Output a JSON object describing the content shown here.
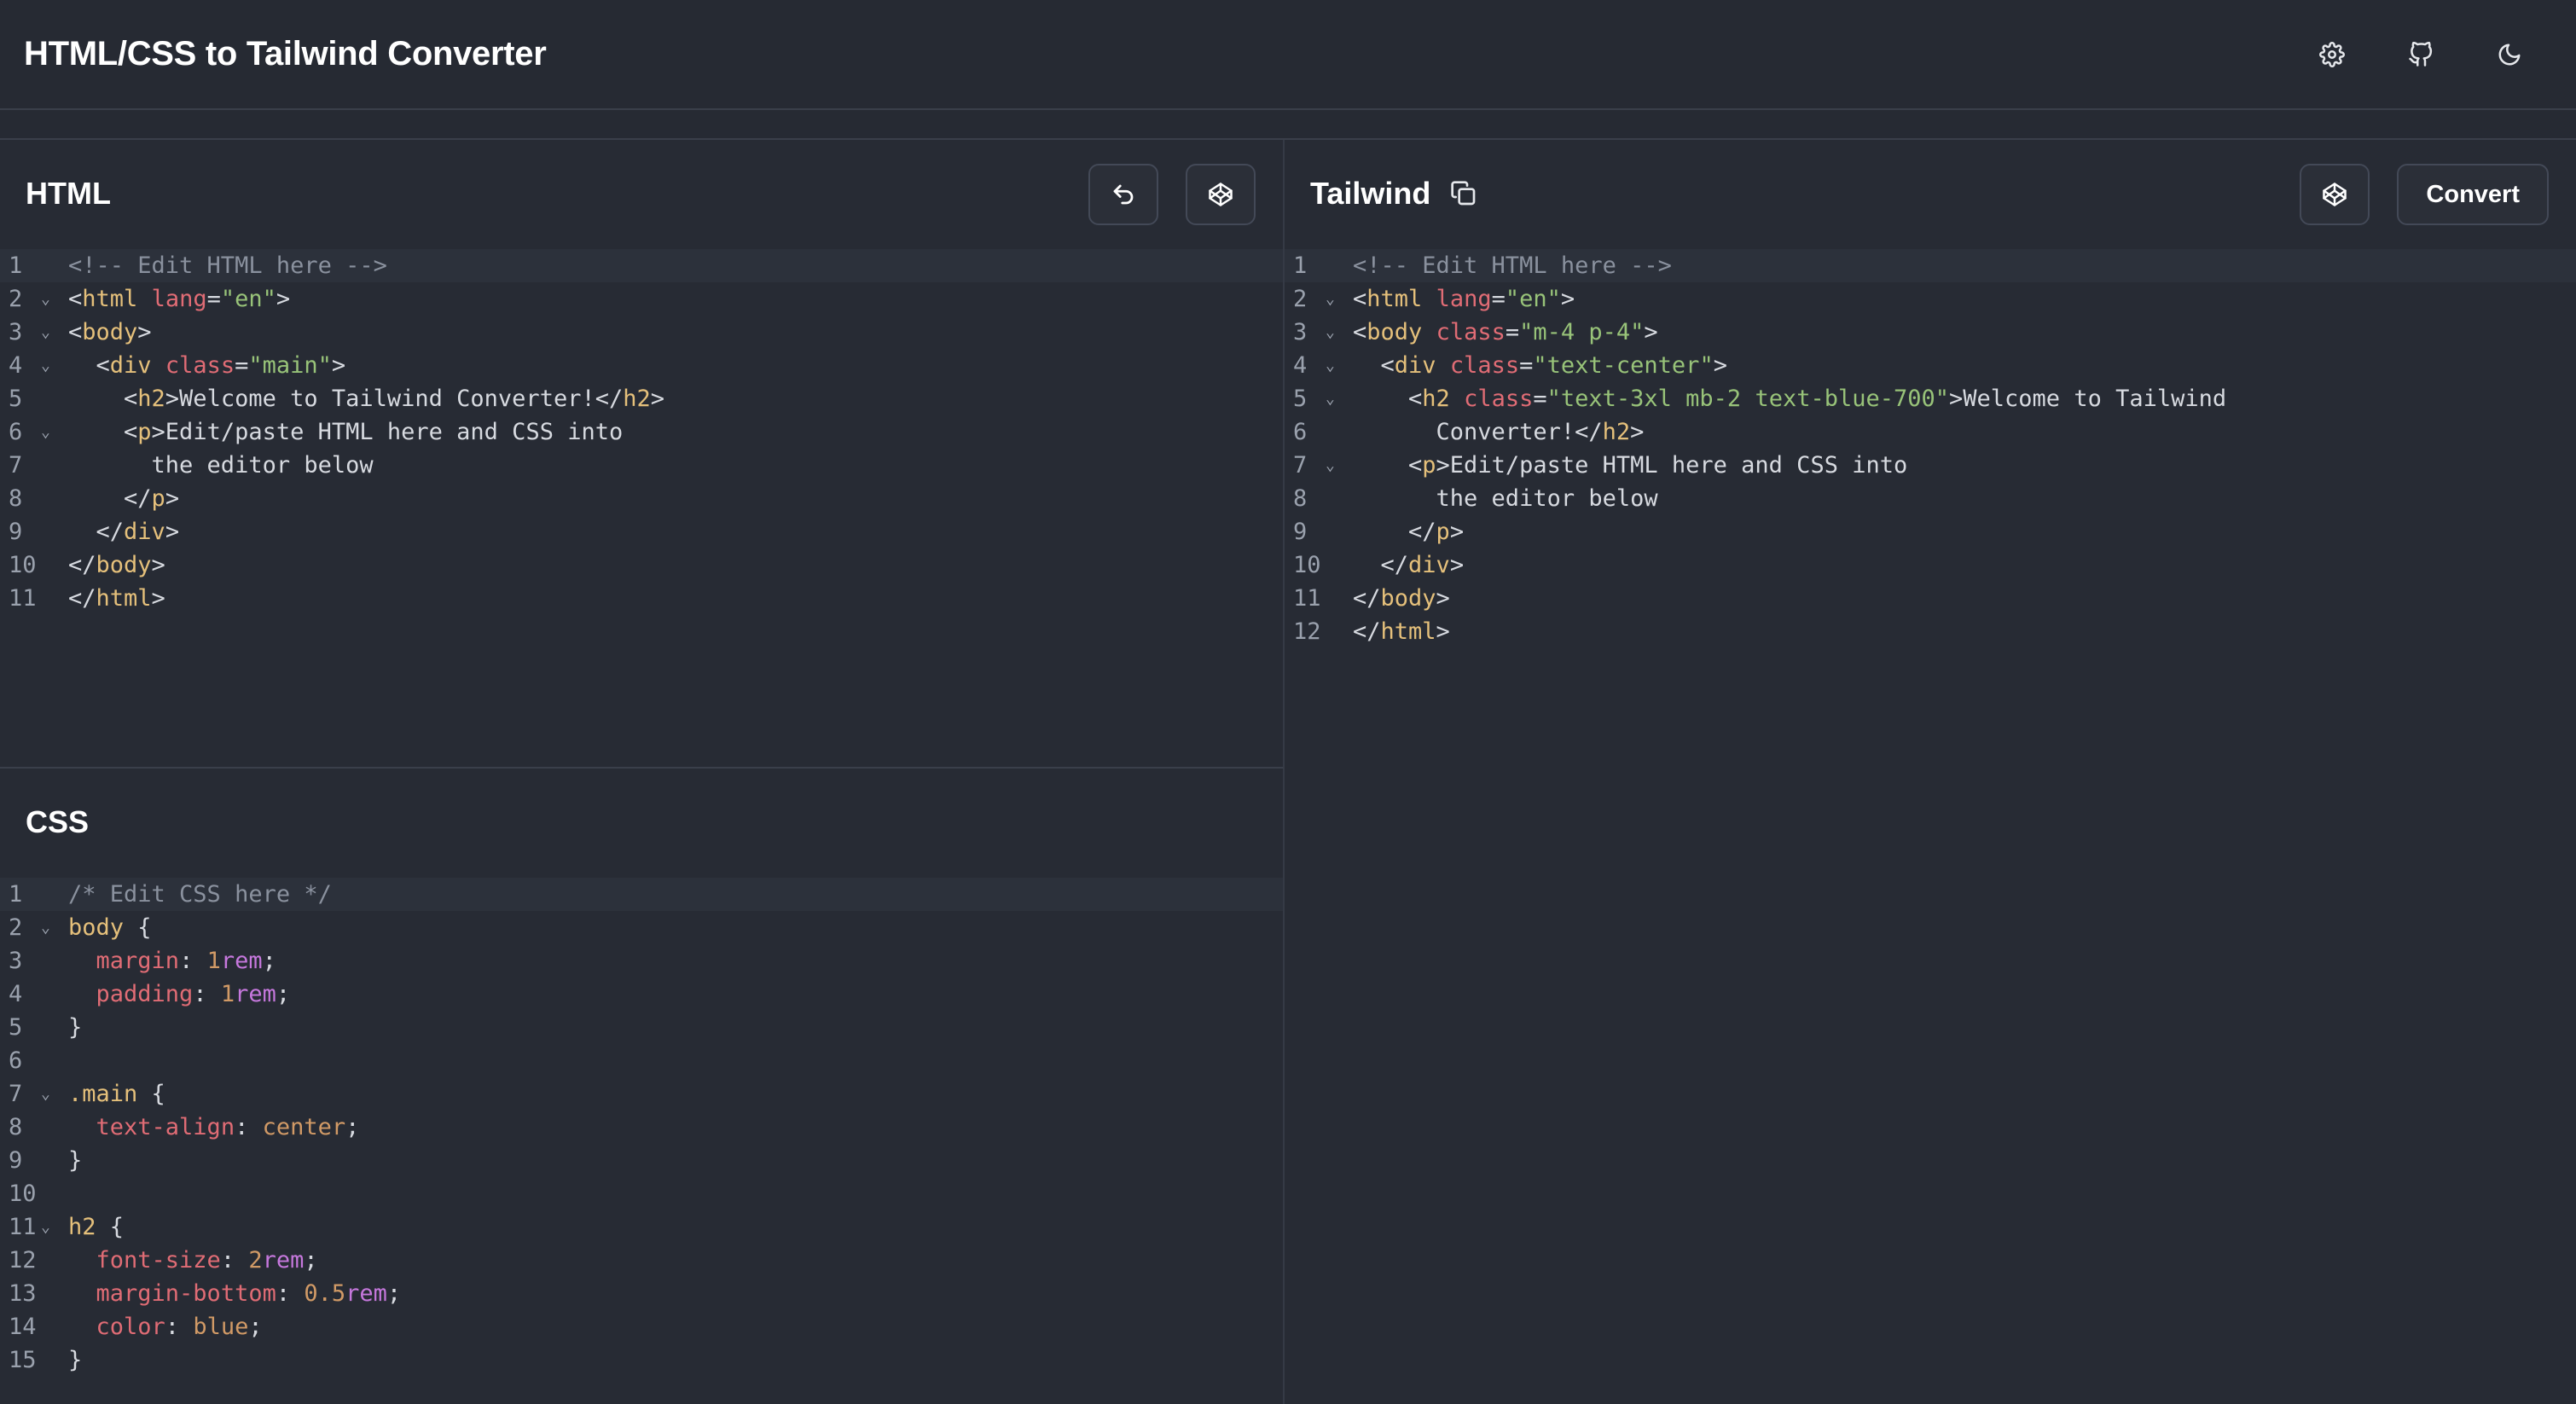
{
  "app": {
    "title": "HTML/CSS to Tailwind Converter",
    "icons": [
      "gear-icon",
      "github-icon",
      "moon-icon"
    ]
  },
  "html_pane": {
    "title": "HTML",
    "buttons": {
      "undo": "undo-icon",
      "codepen": "codepen-icon"
    },
    "lines": [
      [
        {
          "t": "<!-- Edit HTML here -->",
          "c": "com"
        }
      ],
      [
        {
          "t": "<",
          "c": "txt"
        },
        {
          "t": "html",
          "c": "tag"
        },
        {
          "t": " ",
          "c": "txt"
        },
        {
          "t": "lang",
          "c": "attr"
        },
        {
          "t": "=",
          "c": "txt"
        },
        {
          "t": "\"en\"",
          "c": "str"
        },
        {
          "t": ">",
          "c": "txt"
        }
      ],
      [
        {
          "t": "<",
          "c": "txt"
        },
        {
          "t": "body",
          "c": "tag"
        },
        {
          "t": ">",
          "c": "txt"
        }
      ],
      [
        {
          "t": "  <",
          "c": "txt"
        },
        {
          "t": "div",
          "c": "tag"
        },
        {
          "t": " ",
          "c": "txt"
        },
        {
          "t": "class",
          "c": "attr"
        },
        {
          "t": "=",
          "c": "txt"
        },
        {
          "t": "\"main\"",
          "c": "str"
        },
        {
          "t": ">",
          "c": "txt"
        }
      ],
      [
        {
          "t": "    <",
          "c": "txt"
        },
        {
          "t": "h2",
          "c": "tag"
        },
        {
          "t": ">Welcome to Tailwind Converter!</",
          "c": "txt"
        },
        {
          "t": "h2",
          "c": "tag"
        },
        {
          "t": ">",
          "c": "txt"
        }
      ],
      [
        {
          "t": "    <",
          "c": "txt"
        },
        {
          "t": "p",
          "c": "tag"
        },
        {
          "t": ">Edit/paste HTML here and CSS into",
          "c": "txt"
        }
      ],
      [
        {
          "t": "      the editor below",
          "c": "txt"
        }
      ],
      [
        {
          "t": "    </",
          "c": "txt"
        },
        {
          "t": "p",
          "c": "tag"
        },
        {
          "t": ">",
          "c": "txt"
        }
      ],
      [
        {
          "t": "  </",
          "c": "txt"
        },
        {
          "t": "div",
          "c": "tag"
        },
        {
          "t": ">",
          "c": "txt"
        }
      ],
      [
        {
          "t": "</",
          "c": "txt"
        },
        {
          "t": "body",
          "c": "tag"
        },
        {
          "t": ">",
          "c": "txt"
        }
      ],
      [
        {
          "t": "</",
          "c": "txt"
        },
        {
          "t": "html",
          "c": "tag"
        },
        {
          "t": ">",
          "c": "txt"
        }
      ]
    ],
    "folds": [
      2,
      3,
      4,
      6
    ]
  },
  "css_pane": {
    "title": "CSS",
    "lines": [
      [
        {
          "t": "/* Edit CSS here */",
          "c": "com"
        }
      ],
      [
        {
          "t": "body",
          "c": "sel"
        },
        {
          "t": " {",
          "c": "txt"
        }
      ],
      [
        {
          "t": "  ",
          "c": "txt"
        },
        {
          "t": "margin",
          "c": "prop"
        },
        {
          "t": ": ",
          "c": "txt"
        },
        {
          "t": "1",
          "c": "num"
        },
        {
          "t": "rem",
          "c": "unit"
        },
        {
          "t": ";",
          "c": "txt"
        }
      ],
      [
        {
          "t": "  ",
          "c": "txt"
        },
        {
          "t": "padding",
          "c": "prop"
        },
        {
          "t": ": ",
          "c": "txt"
        },
        {
          "t": "1",
          "c": "num"
        },
        {
          "t": "rem",
          "c": "unit"
        },
        {
          "t": ";",
          "c": "txt"
        }
      ],
      [
        {
          "t": "}",
          "c": "txt"
        }
      ],
      [],
      [
        {
          "t": ".main",
          "c": "sel"
        },
        {
          "t": " {",
          "c": "txt"
        }
      ],
      [
        {
          "t": "  ",
          "c": "txt"
        },
        {
          "t": "text-align",
          "c": "prop"
        },
        {
          "t": ": ",
          "c": "txt"
        },
        {
          "t": "center",
          "c": "val"
        },
        {
          "t": ";",
          "c": "txt"
        }
      ],
      [
        {
          "t": "}",
          "c": "txt"
        }
      ],
      [],
      [
        {
          "t": "h2",
          "c": "sel"
        },
        {
          "t": " {",
          "c": "txt"
        }
      ],
      [
        {
          "t": "  ",
          "c": "txt"
        },
        {
          "t": "font-size",
          "c": "prop"
        },
        {
          "t": ": ",
          "c": "txt"
        },
        {
          "t": "2",
          "c": "num"
        },
        {
          "t": "rem",
          "c": "unit"
        },
        {
          "t": ";",
          "c": "txt"
        }
      ],
      [
        {
          "t": "  ",
          "c": "txt"
        },
        {
          "t": "margin-bottom",
          "c": "prop"
        },
        {
          "t": ": ",
          "c": "txt"
        },
        {
          "t": "0.5",
          "c": "num"
        },
        {
          "t": "rem",
          "c": "unit"
        },
        {
          "t": ";",
          "c": "txt"
        }
      ],
      [
        {
          "t": "  ",
          "c": "txt"
        },
        {
          "t": "color",
          "c": "prop"
        },
        {
          "t": ": ",
          "c": "txt"
        },
        {
          "t": "blue",
          "c": "val"
        },
        {
          "t": ";",
          "c": "txt"
        }
      ],
      [
        {
          "t": "}",
          "c": "txt"
        }
      ]
    ],
    "folds": [
      2,
      7,
      11
    ]
  },
  "tailwind_pane": {
    "title": "Tailwind",
    "convert_label": "Convert",
    "buttons": {
      "copy": "copy-icon",
      "codepen": "codepen-icon"
    },
    "lines": [
      [
        {
          "t": "<!-- Edit HTML here -->",
          "c": "com"
        }
      ],
      [
        {
          "t": "<",
          "c": "txt"
        },
        {
          "t": "html",
          "c": "tag"
        },
        {
          "t": " ",
          "c": "txt"
        },
        {
          "t": "lang",
          "c": "attr"
        },
        {
          "t": "=",
          "c": "txt"
        },
        {
          "t": "\"en\"",
          "c": "str"
        },
        {
          "t": ">",
          "c": "txt"
        }
      ],
      [
        {
          "t": "<",
          "c": "txt"
        },
        {
          "t": "body",
          "c": "tag"
        },
        {
          "t": " ",
          "c": "txt"
        },
        {
          "t": "class",
          "c": "attr"
        },
        {
          "t": "=",
          "c": "txt"
        },
        {
          "t": "\"m-4 p-4\"",
          "c": "str"
        },
        {
          "t": ">",
          "c": "txt"
        }
      ],
      [
        {
          "t": "  <",
          "c": "txt"
        },
        {
          "t": "div",
          "c": "tag"
        },
        {
          "t": " ",
          "c": "txt"
        },
        {
          "t": "class",
          "c": "attr"
        },
        {
          "t": "=",
          "c": "txt"
        },
        {
          "t": "\"text-center\"",
          "c": "str"
        },
        {
          "t": ">",
          "c": "txt"
        }
      ],
      [
        {
          "t": "    <",
          "c": "txt"
        },
        {
          "t": "h2",
          "c": "tag"
        },
        {
          "t": " ",
          "c": "txt"
        },
        {
          "t": "class",
          "c": "attr"
        },
        {
          "t": "=",
          "c": "txt"
        },
        {
          "t": "\"text-3xl mb-2 text-blue-700\"",
          "c": "str"
        },
        {
          "t": ">Welcome to Tailwind",
          "c": "txt"
        }
      ],
      [
        {
          "t": "      Converter!</",
          "c": "txt"
        },
        {
          "t": "h2",
          "c": "tag"
        },
        {
          "t": ">",
          "c": "txt"
        }
      ],
      [
        {
          "t": "    <",
          "c": "txt"
        },
        {
          "t": "p",
          "c": "tag"
        },
        {
          "t": ">Edit/paste HTML here and CSS into",
          "c": "txt"
        }
      ],
      [
        {
          "t": "      the editor below",
          "c": "txt"
        }
      ],
      [
        {
          "t": "    </",
          "c": "txt"
        },
        {
          "t": "p",
          "c": "tag"
        },
        {
          "t": ">",
          "c": "txt"
        }
      ],
      [
        {
          "t": "  </",
          "c": "txt"
        },
        {
          "t": "div",
          "c": "tag"
        },
        {
          "t": ">",
          "c": "txt"
        }
      ],
      [
        {
          "t": "</",
          "c": "txt"
        },
        {
          "t": "body",
          "c": "tag"
        },
        {
          "t": ">",
          "c": "txt"
        }
      ],
      [
        {
          "t": "</",
          "c": "txt"
        },
        {
          "t": "html",
          "c": "tag"
        },
        {
          "t": ">",
          "c": "txt"
        }
      ]
    ],
    "folds": [
      2,
      3,
      4,
      5,
      7
    ]
  },
  "colors": {
    "background": "#262a33",
    "comment": "#8a919e",
    "tag": "#e5c07b",
    "attribute": "#e06c75",
    "string": "#98c379",
    "number": "#d19a66",
    "unit": "#c678dd"
  }
}
